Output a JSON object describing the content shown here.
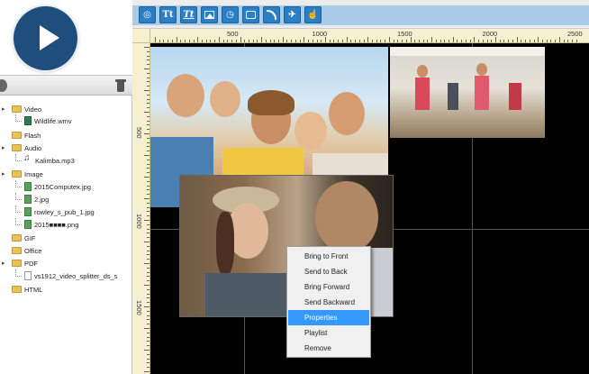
{
  "colors": {
    "accent_blue": "#2b7fc4",
    "play_button": "#1f4d7c",
    "menu_highlight": "#3399ff",
    "ruler": "#f5f0d2",
    "stage": "#000000"
  },
  "player": {
    "icon": "play-icon"
  },
  "library": {
    "left_icon": "tag-icon",
    "delete_icon": "trash-icon"
  },
  "tree": [
    {
      "label": "Video",
      "kind": "folder",
      "depth": 0
    },
    {
      "label": "Wildlife.wmv",
      "kind": "video",
      "depth": 1
    },
    {
      "label": "Flash",
      "kind": "folder",
      "depth": 0
    },
    {
      "label": "Audio",
      "kind": "folder",
      "depth": 0
    },
    {
      "label": "Kalimba.mp3",
      "kind": "audio",
      "depth": 1
    },
    {
      "label": "Image",
      "kind": "folder",
      "depth": 0
    },
    {
      "label": "2015Computex.jpg",
      "kind": "image",
      "depth": 1
    },
    {
      "label": "2.jpg",
      "kind": "image",
      "depth": 1
    },
    {
      "label": "rowley_s_pub_1.jpg",
      "kind": "image",
      "depth": 1
    },
    {
      "label": "2015■■■■.png",
      "kind": "image",
      "depth": 1
    },
    {
      "label": "GIF",
      "kind": "folder",
      "depth": 0
    },
    {
      "label": "Office",
      "kind": "folder",
      "depth": 0
    },
    {
      "label": "PDF",
      "kind": "folder",
      "depth": 0
    },
    {
      "label": "vs1912_video_splitter_ds_s",
      "kind": "file",
      "depth": 1
    },
    {
      "label": "HTML",
      "kind": "folder",
      "depth": 0
    }
  ],
  "toolbar": {
    "buttons": [
      {
        "icon": "globe-icon",
        "glyph": "◎"
      },
      {
        "icon": "text-icon",
        "glyph": "Tt"
      },
      {
        "icon": "italic-text-icon",
        "glyph": "Tt"
      },
      {
        "icon": "image-icon",
        "glyph": ""
      },
      {
        "icon": "clock-icon",
        "glyph": "◷"
      },
      {
        "icon": "screen-icon",
        "glyph": ""
      },
      {
        "icon": "rss-icon",
        "glyph": ""
      },
      {
        "icon": "rocket-icon",
        "glyph": "✈"
      },
      {
        "icon": "hand-icon",
        "glyph": "☝"
      }
    ]
  },
  "ruler": {
    "horizontal_labels": [
      "500",
      "1000",
      "1500",
      "2000",
      "2500"
    ],
    "vertical_labels": [
      "500",
      "1000",
      "1500"
    ]
  },
  "canvas": {
    "photos": [
      {
        "name": "photo-kids",
        "description_icon": "kids-photo"
      },
      {
        "name": "photo-gym",
        "description_icon": "gym-photo"
      },
      {
        "name": "photo-couple",
        "description_icon": "couple-photo"
      }
    ]
  },
  "context_menu": {
    "items": [
      "Bring to Front",
      "Send to Back",
      "Bring Forward",
      "Send Backward",
      "Properties",
      "Playlist",
      "Remove"
    ],
    "selected_index": 4
  }
}
